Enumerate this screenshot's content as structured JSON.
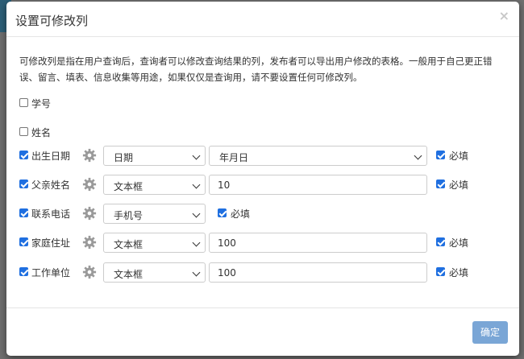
{
  "modal": {
    "title": "设置可修改列",
    "close": "×",
    "intro": "可修改列是指在用户查询后，查询者可以修改查询结果的列，发布者可以导出用户修改的表格。一般用于自己更正错误、留言、填表、信息收集等用途，如果仅仅是查询用，请不要设置任何可修改列。",
    "ok_label": "确定"
  },
  "fields": [
    {
      "label": "学号",
      "checked": false
    },
    {
      "label": "姓名",
      "checked": false
    },
    {
      "label": "出生日期",
      "checked": true,
      "type": "日期",
      "format": "年月日",
      "required": true,
      "required_label": "必填"
    },
    {
      "label": "父亲姓名",
      "checked": true,
      "type": "文本框",
      "value": "10",
      "required": true,
      "required_label": "必填"
    },
    {
      "label": "联系电话",
      "checked": true,
      "type": "手机号",
      "required": true,
      "required_label": "必填"
    },
    {
      "label": "家庭住址",
      "checked": true,
      "type": "文本框",
      "value": "100",
      "required": true,
      "required_label": "必填"
    },
    {
      "label": "工作单位",
      "checked": true,
      "type": "文本框",
      "value": "100",
      "required": true,
      "required_label": "必填"
    }
  ],
  "icons": {
    "settings": "gear-icon",
    "dropdown": "chevron-down-icon",
    "close": "close-icon"
  },
  "colors": {
    "primary_button": "#7aa6d6",
    "checkbox_on": "#1f6fe0"
  }
}
